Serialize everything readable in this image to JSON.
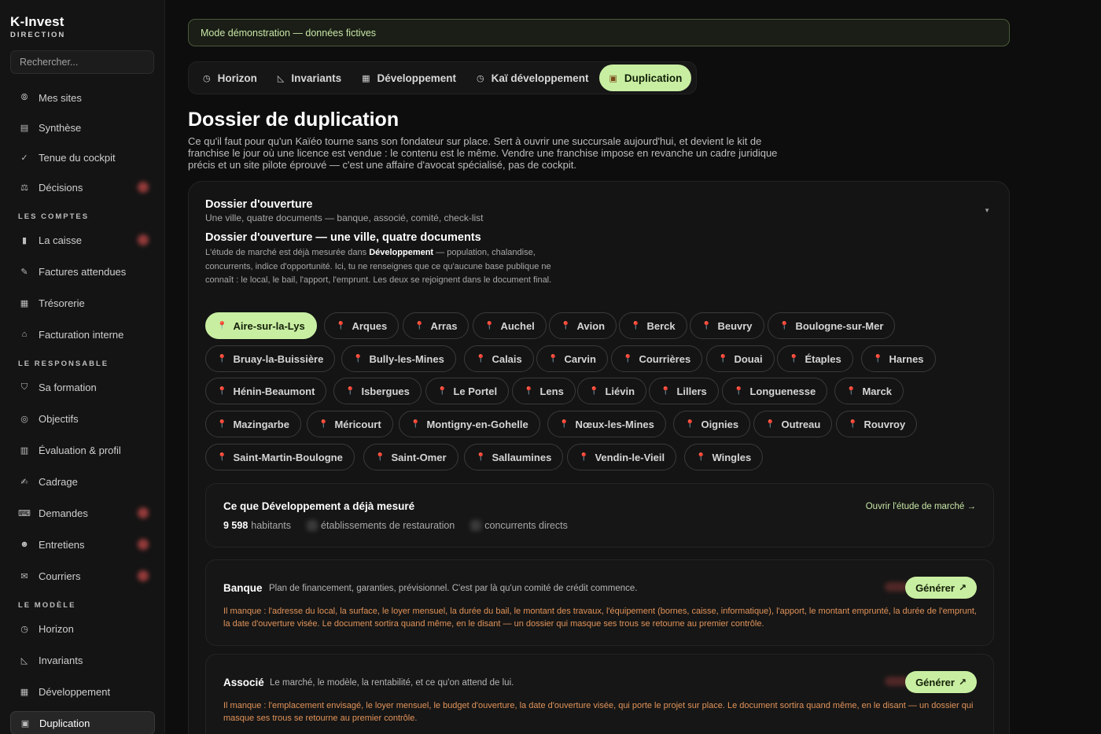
{
  "brand": {
    "title": "K-Invest",
    "subtitle": "DIRECTION"
  },
  "search": {
    "placeholder": "Rechercher..."
  },
  "sidebar": {
    "items_top": [
      {
        "label": "Mes sites",
        "icon": "⦾",
        "badge": false
      },
      {
        "label": "Synthèse",
        "icon": "▤",
        "badge": false
      },
      {
        "label": "Tenue du cockpit",
        "icon": "✓",
        "badge": false
      },
      {
        "label": "Décisions",
        "icon": "⚖",
        "badge": true
      }
    ],
    "section_comptes": "LES COMPTES",
    "items_comptes": [
      {
        "label": "La caisse",
        "icon": "▮",
        "badge": true
      },
      {
        "label": "Factures attendues",
        "icon": "✎",
        "badge": false
      },
      {
        "label": "Trésorerie",
        "icon": "▦",
        "badge": false
      },
      {
        "label": "Facturation interne",
        "icon": "⌂",
        "badge": false
      }
    ],
    "section_responsable": "LE RESPONSABLE",
    "items_responsable": [
      {
        "label": "Sa formation",
        "icon": "⛉",
        "badge": false
      },
      {
        "label": "Objectifs",
        "icon": "◎",
        "badge": false
      },
      {
        "label": "Évaluation & profil",
        "icon": "▥",
        "badge": false
      },
      {
        "label": "Cadrage",
        "icon": "✍",
        "badge": false
      },
      {
        "label": "Demandes",
        "icon": "⌨",
        "badge": true
      },
      {
        "label": "Entretiens",
        "icon": "☻",
        "badge": true
      },
      {
        "label": "Courriers",
        "icon": "✉",
        "badge": true
      }
    ],
    "section_modele": "LE MODÈLE",
    "items_modele": [
      {
        "label": "Horizon",
        "icon": "◷",
        "badge": false
      },
      {
        "label": "Invariants",
        "icon": "◺",
        "badge": false
      },
      {
        "label": "Développement",
        "icon": "▦",
        "badge": false
      },
      {
        "label": "Duplication",
        "icon": "▣",
        "badge": false,
        "active": true
      }
    ]
  },
  "banner": {
    "text": "Mode démonstration — données fictives"
  },
  "tabs": [
    {
      "label": "Horizon",
      "icon": "◷"
    },
    {
      "label": "Invariants",
      "icon": "◺"
    },
    {
      "label": "Développement",
      "icon": "▦"
    },
    {
      "label": "Kaï développement",
      "icon": "◷"
    },
    {
      "label": "Duplication",
      "icon": "▣",
      "active": true
    }
  ],
  "page": {
    "title": "Dossier de duplication",
    "description": "Ce qu'il faut pour qu'un Kaïéo tourne sans son fondateur sur place. Sert à ouvrir une succursale aujourd'hui, et devient le kit de franchise le jour où une licence est vendue : le contenu est le même. Vendre une franchise impose en revanche un cadre juridique précis et un site pilote éprouvé — c'est une affaire d'avocat spécialisé, pas de cockpit."
  },
  "dossier": {
    "title": "Dossier d'ouverture",
    "subtitle": "Une ville, quatre documents — banque, associé, comité, check-list",
    "section_title": "Dossier d'ouverture — une ville, quatre documents",
    "desc_before": "L'étude de marché est déjà mesurée dans ",
    "desc_bold": "Développement",
    "desc_after": " — population, chalandise, concurrents, indice d'opportunité. Ici, tu ne renseignes que ce qu'aucune base publique ne connaît : le local, le bail, l'apport, l'emprunt. Les deux se rejoignent dans le document final.",
    "selected_city": "Aire-sur-la-Lys",
    "cities": [
      "Aire-sur-la-Lys",
      "Arques",
      "Arras",
      "Auchel",
      "Avion",
      "Berck",
      "Beuvry",
      "Boulogne-sur-Mer",
      "Bruay-la-Buissière",
      "Bully-les-Mines",
      "Calais",
      "Carvin",
      "Courrières",
      "Douai",
      "Étaples",
      "Harnes",
      "Hénin-Beaumont",
      "Isbergues",
      "Le Portel",
      "Lens",
      "Liévin",
      "Lillers",
      "Longuenesse",
      "Marck",
      "Mazingarbe",
      "Méricourt",
      "Montigny-en-Gohelle",
      "Nœux-les-Mines",
      "Oignies",
      "Outreau",
      "Rouvroy",
      "Saint-Martin-Boulogne",
      "Saint-Omer",
      "Sallaumines",
      "Vendin-le-Vieil",
      "Wingles"
    ]
  },
  "measured": {
    "title": "Ce que Développement a déjà mesuré",
    "link": "Ouvrir l'étude de marché →",
    "population_value": "9 598",
    "population_label": "habitants",
    "restaurants_label": "établissements de restauration",
    "competitors_label": "concurrents directs"
  },
  "documents": [
    {
      "title": "Banque",
      "subtitle": "Plan de financement, garanties, prévisionnel. C'est par là qu'un comité de crédit commence.",
      "button": "Générer",
      "missing": "Il manque : l'adresse du local, la surface, le loyer mensuel, la durée du bail, le montant des travaux, l'équipement (bornes, caisse, informatique), l'apport, le montant emprunté, la durée de l'emprunt, la date d'ouverture visée. Le document sortira quand même, en le disant — un dossier qui masque ses trous se retourne au premier contrôle."
    },
    {
      "title": "Associé",
      "subtitle": "Le marché, le modèle, la rentabilité, et ce qu'on attend de lui.",
      "button": "Générer",
      "missing": "Il manque : l'emplacement envisagé, le loyer mensuel, le budget d'ouverture, la date d'ouverture visée, qui porte le projet sur place. Le document sortira quand même, en le disant — un dossier qui masque ses trous se retourne au premier contrôle."
    }
  ],
  "colors": {
    "accent": "#c8eea2",
    "warning": "#e0935a",
    "background": "#0d0d0d"
  }
}
